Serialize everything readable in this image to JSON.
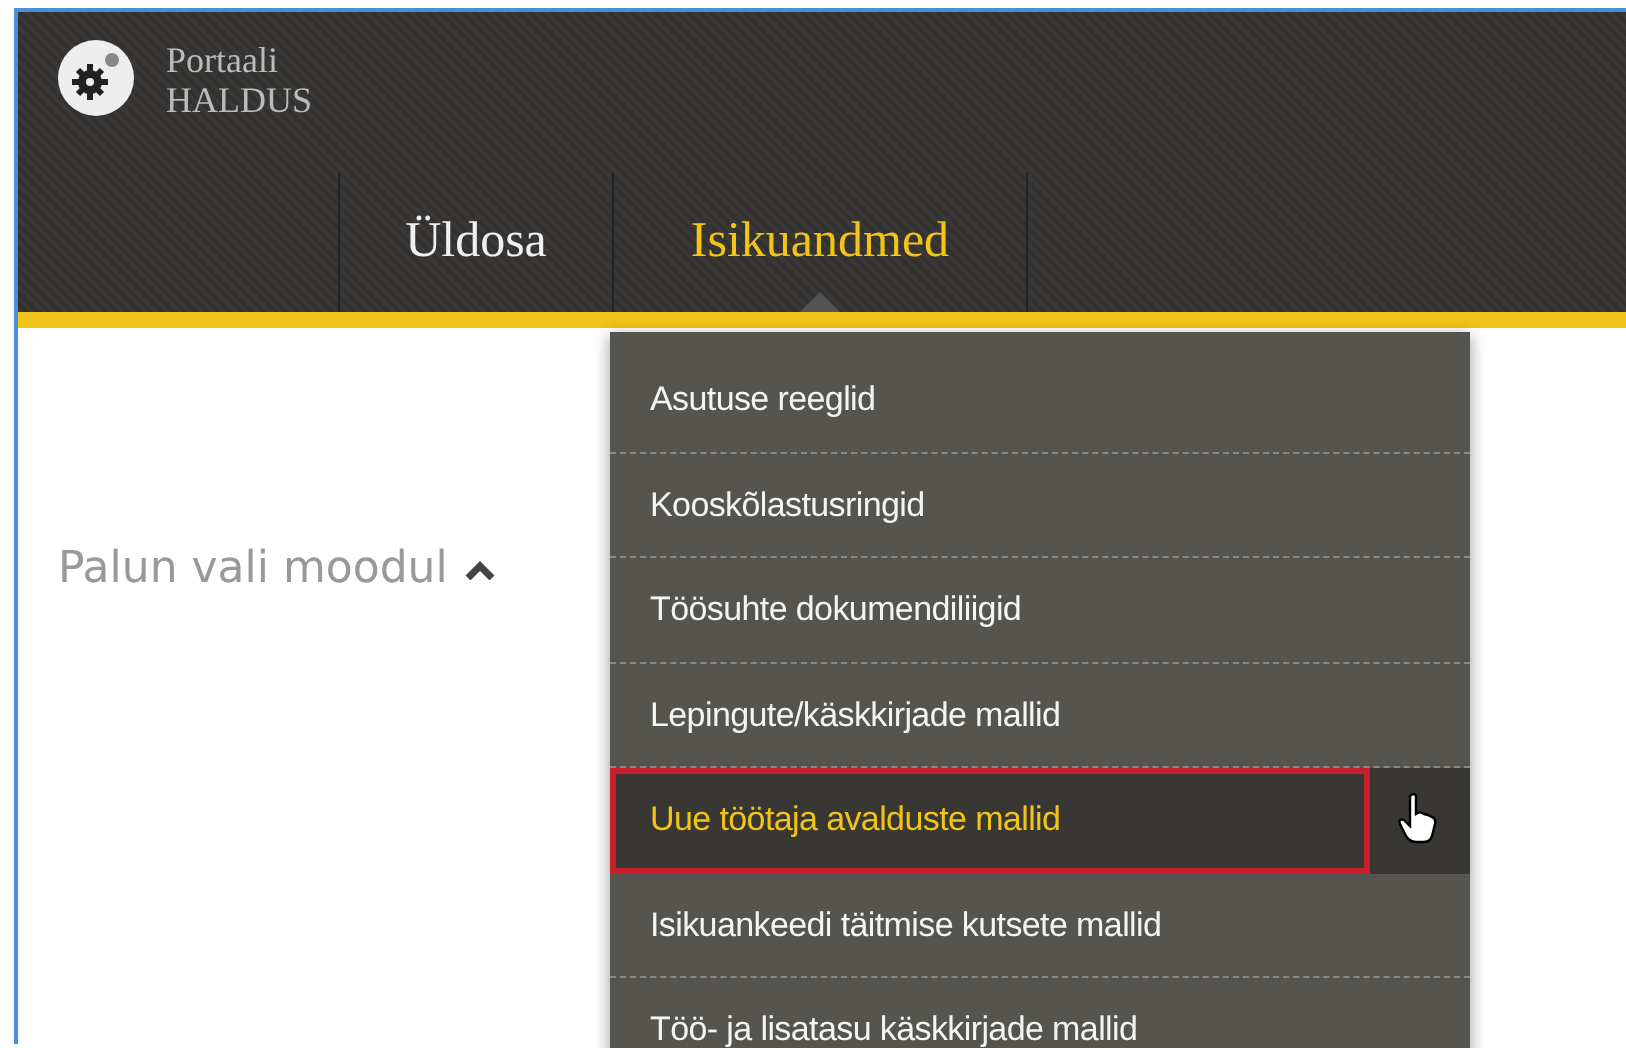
{
  "brand": {
    "line_1": "Portaali",
    "line_2": "HALDUS"
  },
  "tabs": [
    {
      "label": "Üldosa",
      "selected": false
    },
    {
      "label": "Isikuandmed",
      "selected": true
    }
  ],
  "module_prompt": "Palun vali moodul",
  "menu": [
    {
      "label": "Asutuse reeglid",
      "selected": false
    },
    {
      "label": "Kooskõlastusringid",
      "selected": false
    },
    {
      "label": "Töösuhte dokumendiliigid",
      "selected": false
    },
    {
      "label": "Lepingute/käskkirjade mallid",
      "selected": false
    },
    {
      "label": "Uue töötaja avalduste mallid",
      "selected": true
    },
    {
      "label": "Isikuankeedi täitmise kutsete mallid",
      "selected": false
    },
    {
      "label": "Töö- ja lisatasu käskkirjade mallid",
      "selected": false
    }
  ]
}
